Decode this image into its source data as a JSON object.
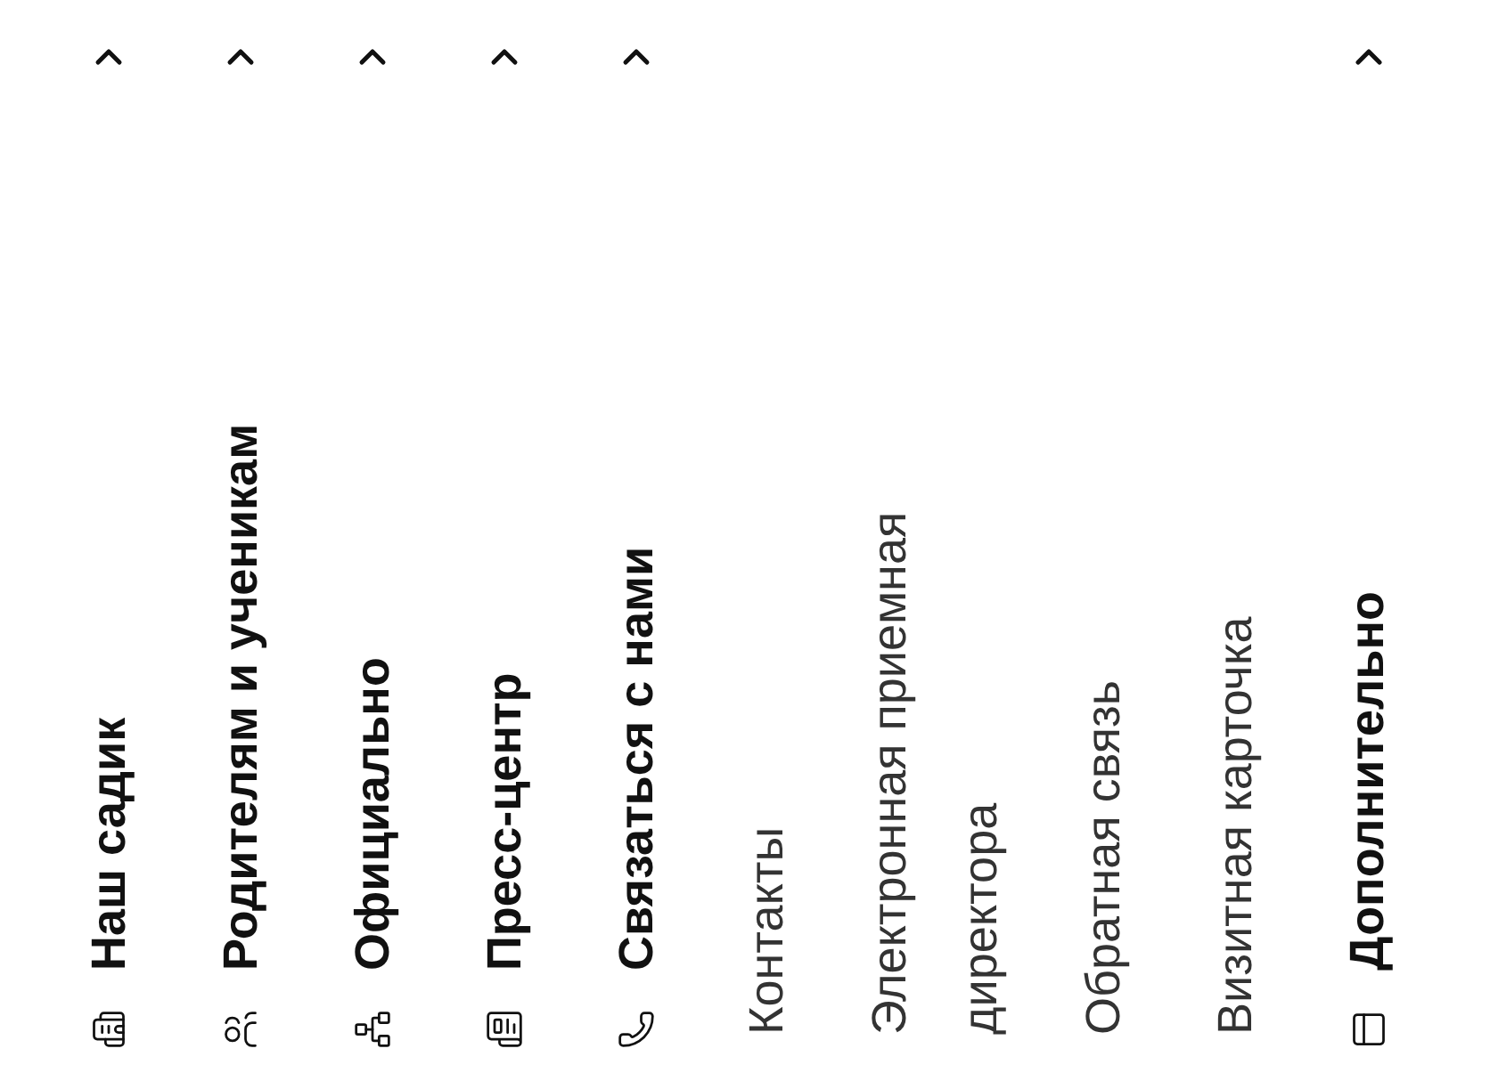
{
  "menu": [
    {
      "kind": "section",
      "label": "Наш садик"
    },
    {
      "kind": "section",
      "label": "Родителям и ученикам"
    },
    {
      "kind": "section",
      "label": "Официально"
    },
    {
      "kind": "section",
      "label": "Пресс-центр"
    },
    {
      "kind": "section",
      "label": "Связаться с нами"
    },
    {
      "kind": "link",
      "label": "Контакты"
    },
    {
      "kind": "link",
      "label": "Электронная приемная директора"
    },
    {
      "kind": "link",
      "label": "Обратная связь"
    },
    {
      "kind": "link",
      "label": "Визитная карточка"
    },
    {
      "kind": "section",
      "label": "Дополнительно"
    }
  ]
}
